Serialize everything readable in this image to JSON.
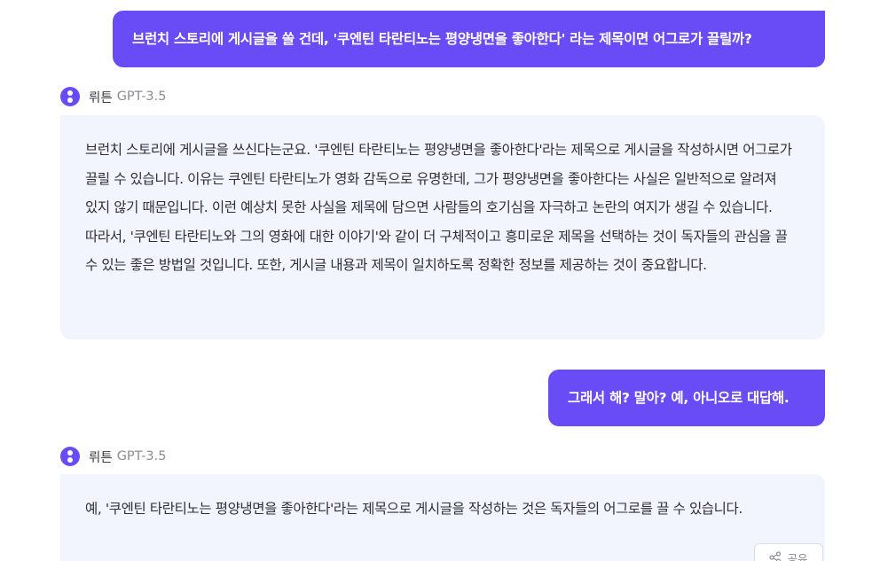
{
  "messages": {
    "user1": "브런치 스토리에 게시글을 쓸 건데, '쿠엔틴 타란티노는 평양냉면을 좋아한다' 라는 제목이면 어그로가 끌릴까?",
    "bot1": {
      "name": "뤼튼",
      "model": "GPT-3.5",
      "text": "브런치 스토리에 게시글을 쓰신다는군요. '쿠엔틴 타란티노는 평양냉면을 좋아한다'라는 제목으로 게시글을 작성하시면 어그로가 끌릴 수 있습니다. 이유는 쿠엔틴 타란티노가 영화 감독으로 유명한데, 그가 평양냉면을 좋아한다는 사실은 일반적으로 알려져 있지 않기 때문입니다. 이런 예상치 못한 사실을 제목에 담으면 사람들의 호기심을 자극하고 논란의 여지가 생길 수 있습니다. 따라서, '쿠엔틴 타란티노와 그의 영화에 대한 이야기'와 같이 더 구체적이고 흥미로운 제목을 선택하는 것이 독자들의 관심을 끌 수 있는 좋은 방법일 것입니다. 또한, 게시글 내용과 제목이 일치하도록 정확한 정보를 제공하는 것이 중요합니다."
    },
    "user2": "그래서 해? 말아? 예, 아니오로 대답해.",
    "bot2": {
      "name": "뤼튼",
      "model": "GPT-3.5",
      "text": "예, '쿠엔틴 타란티노는 평양냉면을 좋아한다'라는 제목으로 게시글을 작성하는 것은 독자들의 어그로를 끌 수 있습니다."
    }
  },
  "share_label": "공유",
  "icons": {
    "bot_avatar": "bot-avatar-icon",
    "share": "share-icon"
  },
  "colors": {
    "accent": "#6a4cf6",
    "bot_bubble": "#f2f5fd"
  }
}
